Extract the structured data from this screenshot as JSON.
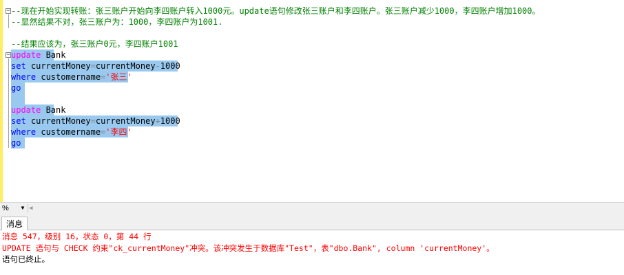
{
  "editor": {
    "lines": [
      {
        "segments": [
          {
            "t": "--现在开始实现转账：张三账户开始向李四账户转入1000元。update语句修改张三账户和李四账户。张三账户减少1000，李四账户增加1000。",
            "c": "cmt"
          }
        ],
        "selected": false
      },
      {
        "segments": [
          {
            "t": "--显然结果不对，张三账户为：1000，李四账户为1001.",
            "c": "cmt"
          }
        ],
        "selected": false
      },
      {
        "segments": [],
        "selected": false
      },
      {
        "segments": [
          {
            "t": "--结果应该为，张三账户0元，李四账户1001",
            "c": "cmt"
          }
        ],
        "selected": false
      },
      {
        "segments": [
          {
            "t": "update",
            "c": "kw2"
          },
          {
            "t": " Bank",
            "c": "id"
          }
        ],
        "selected": true
      },
      {
        "segments": [
          {
            "t": "set",
            "c": "kw"
          },
          {
            "t": " currentMoney",
            "c": "id"
          },
          {
            "t": "=",
            "c": "op"
          },
          {
            "t": "currentMoney",
            "c": "id"
          },
          {
            "t": "-",
            "c": "op"
          },
          {
            "t": "1000",
            "c": "id"
          }
        ],
        "selected": true
      },
      {
        "segments": [
          {
            "t": "where",
            "c": "kw"
          },
          {
            "t": " customername",
            "c": "id"
          },
          {
            "t": "=",
            "c": "op"
          },
          {
            "t": "'张三'",
            "c": "str"
          }
        ],
        "selected": true
      },
      {
        "segments": [
          {
            "t": "go",
            "c": "kw"
          }
        ],
        "selected": true
      },
      {
        "segments": [],
        "selected": true
      },
      {
        "segments": [
          {
            "t": "update",
            "c": "kw2"
          },
          {
            "t": " Bank",
            "c": "id"
          }
        ],
        "selected": true
      },
      {
        "segments": [
          {
            "t": "set",
            "c": "kw"
          },
          {
            "t": " currentMoney",
            "c": "id"
          },
          {
            "t": "=",
            "c": "op"
          },
          {
            "t": "currentMoney",
            "c": "id"
          },
          {
            "t": "+",
            "c": "op"
          },
          {
            "t": "1000",
            "c": "id"
          }
        ],
        "selected": true
      },
      {
        "segments": [
          {
            "t": "where",
            "c": "kw"
          },
          {
            "t": " customername",
            "c": "id"
          },
          {
            "t": "=",
            "c": "op"
          },
          {
            "t": "'李四'",
            "c": "str"
          }
        ],
        "selected": true
      },
      {
        "segments": [
          {
            "t": "go",
            "c": "kw"
          }
        ],
        "selected": true
      }
    ]
  },
  "zoom": {
    "value": "%"
  },
  "results": {
    "tab_label": "消息",
    "messages": [
      {
        "text": "消息 547，级别 16，状态 0，第 44 行",
        "type": "err"
      },
      {
        "text": "UPDATE 语句与 CHECK 约束\"ck_currentMoney\"冲突。该冲突发生于数据库\"Test\"，表\"dbo.Bank\", column 'currentMoney'。",
        "type": "err"
      },
      {
        "text": "语句已终止。",
        "type": "ok"
      }
    ]
  },
  "colors": {
    "selection": "#99c9ef",
    "comment": "#008000",
    "keyword": "#0000ff",
    "error": "#ff0000",
    "change_bar": "#ffee62"
  }
}
